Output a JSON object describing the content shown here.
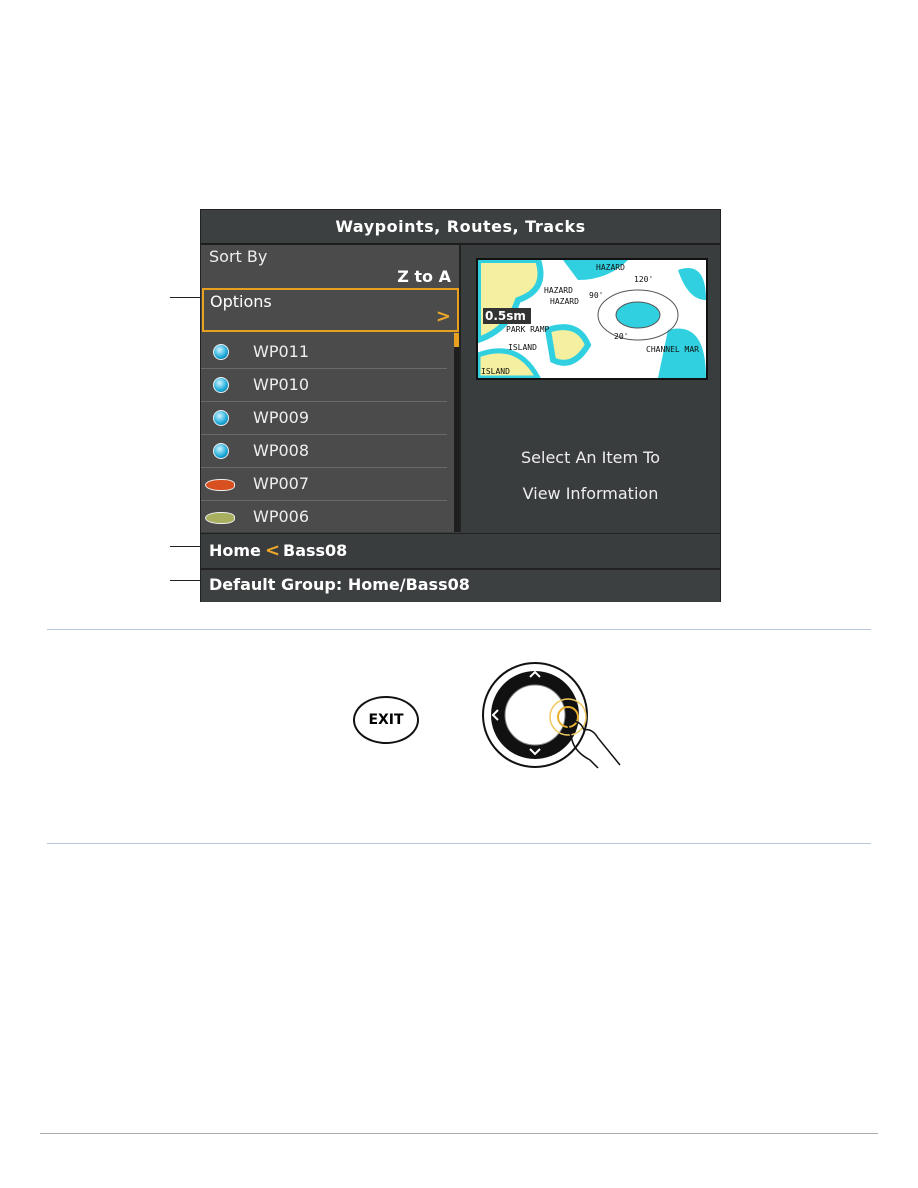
{
  "screen": {
    "title": "Waypoints, Routes, Tracks",
    "sort_label": "Sort By",
    "sort_value": "Z to A",
    "options_label": "Options",
    "options_chevron": ">",
    "items": [
      {
        "name": "WP011",
        "icon": "blue-dot-icon"
      },
      {
        "name": "WP010",
        "icon": "blue-dot-icon"
      },
      {
        "name": "WP009",
        "icon": "blue-dot-icon"
      },
      {
        "name": "WP008",
        "icon": "blue-dot-icon"
      },
      {
        "name": "WP007",
        "icon": "red-fish-icon"
      },
      {
        "name": "WP006",
        "icon": "bass-fish-icon"
      }
    ],
    "map_scale": "0.5sm",
    "map_labels": [
      "HAZARD",
      "HAZARD",
      "HAZARD",
      "PARK RAMP",
      "ISLAND",
      "ISLAND",
      "CHANNEL MAR",
      "120'",
      "90'",
      "20'"
    ],
    "info_line1": "Select An Item To",
    "info_line2": "View Information",
    "breadcrumb_home": "Home",
    "breadcrumb_sep": "<",
    "breadcrumb_current": "Bass08",
    "footer": "Default Group: Home/Bass08"
  },
  "controls": {
    "exit_label": "EXIT"
  },
  "colors": {
    "accent": "#e8a020",
    "panel": "#4b4b4b",
    "header": "#3c4041"
  }
}
